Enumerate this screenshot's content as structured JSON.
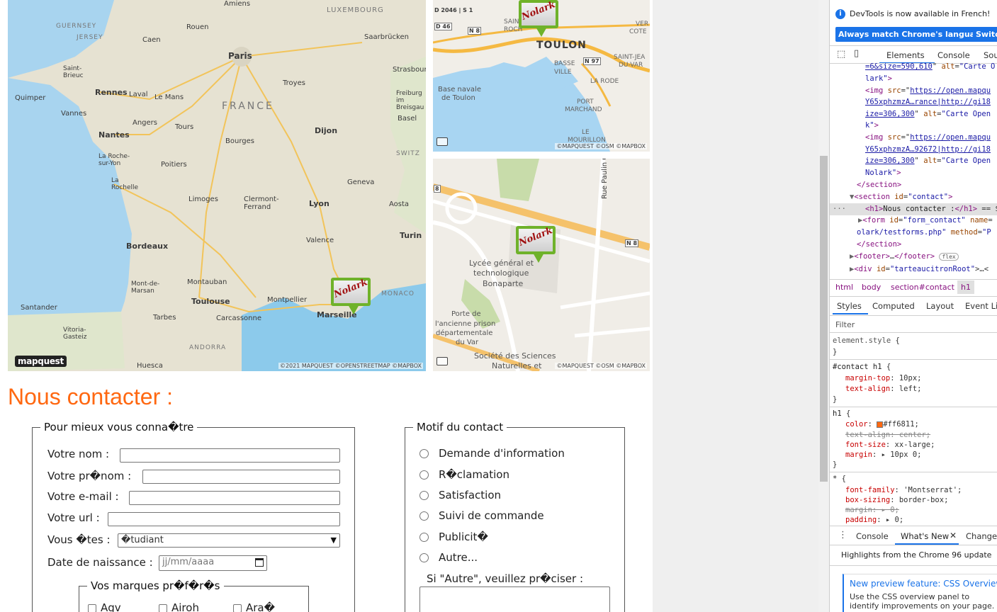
{
  "maps": {
    "france": {
      "labels": [
        "Amiens",
        "LUXEMBOURG",
        "GUERNSEY",
        "JERSEY",
        "Caen",
        "Rouen",
        "Saarbrücken",
        "Paris",
        "Strasbourg",
        "Saint-Brieuc",
        "Troyes",
        "Quimper",
        "Rennes",
        "Laval",
        "Le Mans",
        "FRANCE",
        "Freiburg im Breisgau",
        "Vannes",
        "Angers",
        "Tours",
        "Basel",
        "Nantes",
        "Dijon",
        "Bourges",
        "SWITZ",
        "La Roche-sur-Yon",
        "Poitiers",
        "Geneva",
        "La Rochelle",
        "Limoges",
        "Clermont-Ferrand",
        "Lyon",
        "Aosta",
        "Turin",
        "Bordeaux",
        "Valence",
        "Mont-de-Marsan",
        "Montauban",
        "MONACO",
        "Toulouse",
        "Montpellier",
        "Santander",
        "Tarbes",
        "Carcassonne",
        "Marseille",
        "Vitoria-Gasteiz",
        "ANDORRA",
        "Huesca"
      ],
      "copyright": "©2021 MAPQUEST ©OPENSTREETMAP ©MAPBOX",
      "logo": "mapquest",
      "marker": "Nolark"
    },
    "toulon": {
      "labels": [
        "D 2046 | S 1",
        "D 46",
        "N 8",
        "SAIN",
        "ROCH",
        "VER",
        "COTE",
        "TOULON",
        "N 97",
        "SAINT-JEA",
        "DU-VAR",
        "BASSE",
        "VILLE",
        "LA RODE",
        "Base navale",
        "de Toulon",
        "PORT",
        "MARCHAND",
        "LE",
        "MOURILLON"
      ],
      "copyright": "©MAPQUEST ©OSM ©MAPBOX",
      "marker": "Nolark"
    },
    "lycee": {
      "labels": [
        "Rue Paulin Guérin",
        "N 8",
        "Lycée général et",
        "technologique",
        "Bonaparte",
        "Porte de",
        "l'ancienne prison",
        "départementale",
        "du Var",
        "Société des Sciences",
        "Naturelles et",
        "8"
      ],
      "copyright": "©MAPQUEST ©OSM ©MAPBOX",
      "marker": "Nolark"
    }
  },
  "contact": {
    "title": "Nous contacter :",
    "know": {
      "legend": "Pour mieux vous conna�tre",
      "nom_label": "Votre nom :",
      "prenom_label": "Votre pr�nom :",
      "email_label": "Votre e-mail :",
      "url_label": "Votre url :",
      "status_label": "Vous �tes :",
      "status_value": "�tudiant",
      "birth_label": "Date de naissance :",
      "birth_placeholder": "jj/mm/aaaa",
      "brands_legend": "Vos marques pr�f�r�s",
      "brands": [
        "Agv",
        "Airoh",
        "Ara�"
      ]
    },
    "motif": {
      "legend": "Motif du contact",
      "options": [
        "Demande d'information",
        "R�clamation",
        "Satisfaction",
        "Suivi de commande",
        "Publicit�",
        "Autre..."
      ],
      "other_label": "Si \"Autre\", veuillez pr�ciser :"
    }
  },
  "devtools": {
    "notice": "DevTools is now available in French!",
    "btn_match": "Always match Chrome's language",
    "btn_switch": "Switch",
    "tabs": [
      "Elements",
      "Console",
      "Sou"
    ],
    "breadcrumbs": [
      "html",
      "body",
      "section#contact",
      "h1"
    ],
    "subtabs": [
      "Styles",
      "Computed",
      "Layout",
      "Event Lis"
    ],
    "filter_placeholder": "Filter",
    "drawer_tabs": [
      "Console",
      "What's New",
      "Changes"
    ],
    "highlights": "Highlights from the Chrome 96 update",
    "preview_title": "New preview feature: CSS Overview",
    "preview_text": "Use the CSS overview panel to identify improvements on your page.",
    "color_swatch": "#ff6811"
  }
}
